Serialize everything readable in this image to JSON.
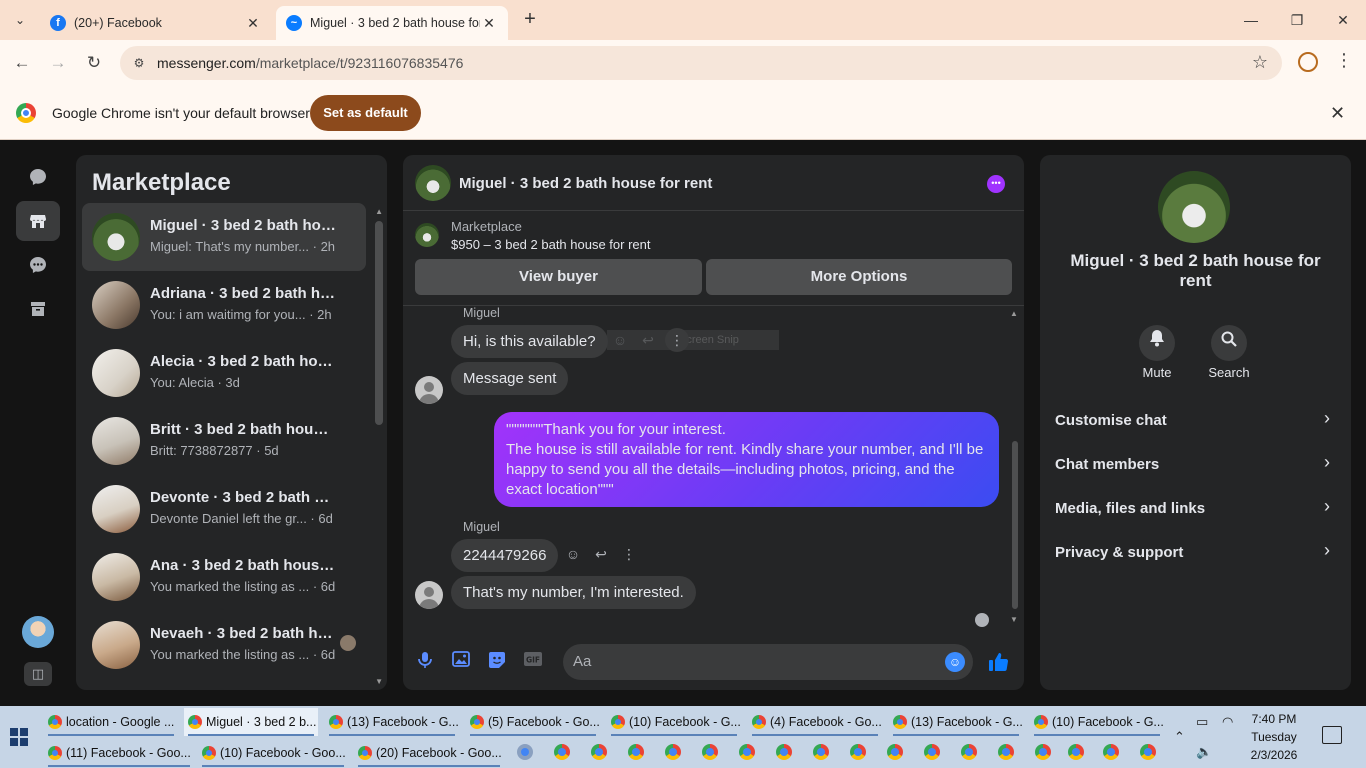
{
  "browser": {
    "tabs": [
      {
        "title": "(20+) Facebook",
        "icon": "facebook-icon"
      },
      {
        "title": "Miguel · 3 bed 2 bath house for rent",
        "icon": "messenger-icon"
      }
    ],
    "url_host": "messenger.com",
    "url_path": "/marketplace/t/923116076835476",
    "infobar_text": "Google Chrome isn't your default browser",
    "infobar_button": "Set as default"
  },
  "list": {
    "title": "Marketplace",
    "conversations": [
      {
        "name": "Miguel · 3 bed 2 bath house for rent",
        "preview": "Miguel: That's my number... · 2h"
      },
      {
        "name": "Adriana · 3 bed 2 bath house for rent",
        "preview": "You: i am waitimg for you... · 2h"
      },
      {
        "name": "Alecia · 3 bed 2 bath house for rent",
        "preview": "You: Alecia · 3d"
      },
      {
        "name": "Britt · 3 bed 2 bath house for rent",
        "preview": "Britt: 7738872877 · 5d"
      },
      {
        "name": "Devonte · 3 bed 2 bath house for rent",
        "preview": "Devonte Daniel left the gr... · 6d"
      },
      {
        "name": "Ana · 3 bed 2 bath house for rent",
        "preview": "You marked the listing as ... · 6d"
      },
      {
        "name": "Nevaeh · 3 bed 2 bath house for rent",
        "preview": "You marked the listing as ... · 6d"
      }
    ]
  },
  "chat": {
    "title": "Miguel · 3 bed 2 bath house for rent",
    "listing_source": "Marketplace",
    "listing_desc": "$950 – 3 bed 2 bath house for rent",
    "view_buyer": "View buyer",
    "more_options": "More Options",
    "sender": "Miguel",
    "messages": {
      "m1": "Hi, is this available?",
      "m2": "Message sent",
      "out": "\"\"\"\"\"\"\"Thank you for your interest.\nThe house is still available for rent. Kindly share your number, and I'll be happy to send you all the details—including photos, pricing, and the exact location\"\"\"",
      "m3": "2244479266",
      "m4": "That's my number, I'm interested."
    },
    "ghost_text": "Screen Snip",
    "composer_placeholder": "Aa"
  },
  "info": {
    "name": "Miguel · 3 bed 2 bath house for rent",
    "mute": "Mute",
    "search": "Search",
    "rows": [
      "Customise chat",
      "Chat members",
      "Media, files and links",
      "Privacy & support"
    ]
  },
  "taskbar": {
    "row1": [
      "location - Google ...",
      "Miguel · 3 bed 2 b...",
      "(13) Facebook - G...",
      "(5) Facebook - Go...",
      "(10) Facebook - G...",
      "(4) Facebook - Go...",
      "(13) Facebook - G...",
      "(10) Facebook - G..."
    ],
    "row2": [
      "(11) Facebook - Goo...",
      "(10) Facebook - Goo...",
      "(20) Facebook - Goo..."
    ],
    "time": "7:40 PM",
    "day": "Tuesday",
    "date": "2/3/2026"
  },
  "colors": {
    "accent_purple": "#a033ff",
    "messenger_blue": "#0084ff",
    "set_default_button": "#8c4a1c"
  }
}
